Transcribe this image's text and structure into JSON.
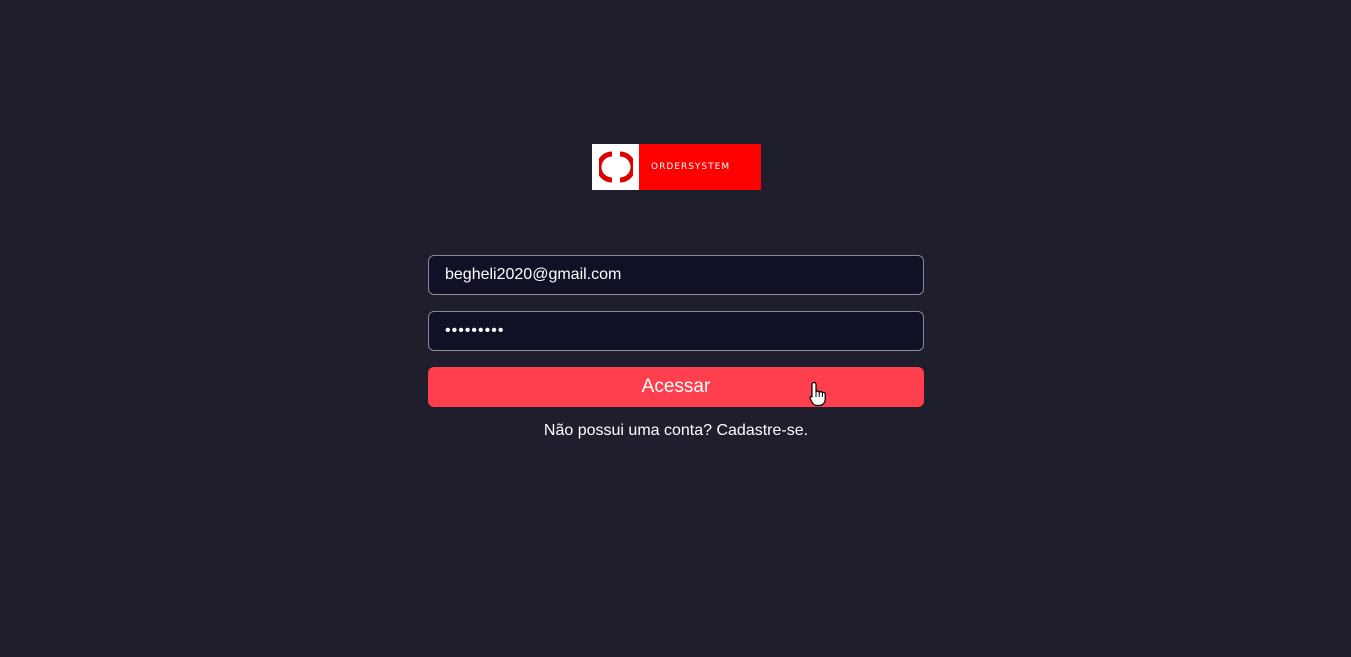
{
  "logo": {
    "text": "ORDERSYSTEM",
    "colors": {
      "background": "#ff0000",
      "mark_background": "#ffffff",
      "mark": "#e00000"
    }
  },
  "login": {
    "email_value": "begheli2020@gmail.com",
    "password_value": "•••••••••",
    "submit_label": "Acessar",
    "signup_link": "Não possui uma conta? Cadastre-se."
  },
  "colors": {
    "page_background": "#1f1e2d",
    "input_background": "#101026",
    "accent": "#ff3f4e"
  },
  "icons": {
    "cursor": "hand-pointer-icon"
  }
}
